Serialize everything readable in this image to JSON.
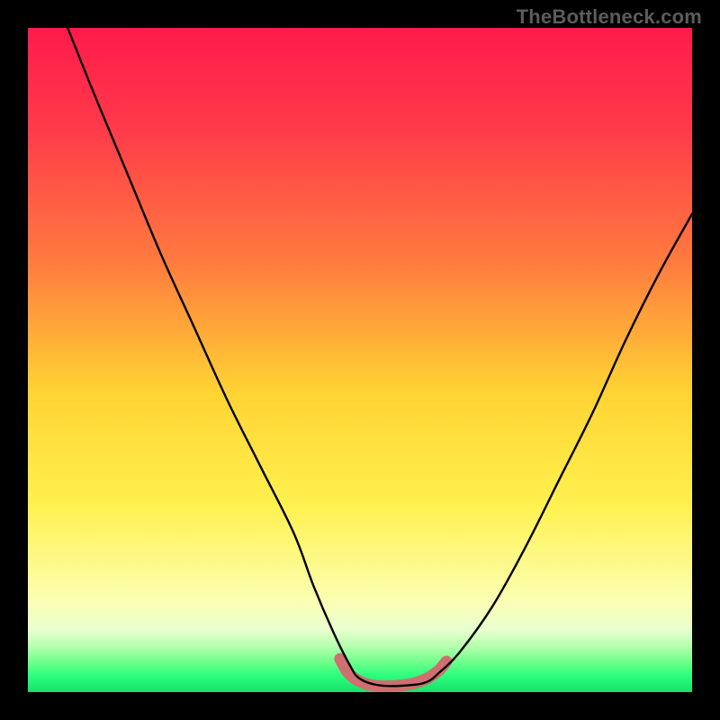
{
  "watermark": "TheBottleneck.com",
  "chart_data": {
    "type": "line",
    "title": "",
    "xlabel": "",
    "ylabel": "",
    "xlim": [
      0,
      100
    ],
    "ylim": [
      0,
      100
    ],
    "gradient_stops": [
      {
        "offset": 0.0,
        "color": "#ff1a4b"
      },
      {
        "offset": 0.15,
        "color": "#ff3a4a"
      },
      {
        "offset": 0.35,
        "color": "#ff7a3f"
      },
      {
        "offset": 0.55,
        "color": "#ffd433"
      },
      {
        "offset": 0.72,
        "color": "#fff150"
      },
      {
        "offset": 0.86,
        "color": "#fbffb0"
      },
      {
        "offset": 0.905,
        "color": "#eaffd0"
      },
      {
        "offset": 0.93,
        "color": "#b8ffb0"
      },
      {
        "offset": 0.955,
        "color": "#6fff8a"
      },
      {
        "offset": 0.975,
        "color": "#2bff7d"
      },
      {
        "offset": 1.0,
        "color": "#18e06c"
      }
    ],
    "series": [
      {
        "name": "bottleneck-curve",
        "x": [
          6,
          10,
          15,
          20,
          25,
          30,
          35,
          40,
          43,
          46,
          48.5,
          50,
          53,
          57,
          60,
          62,
          65,
          70,
          75,
          80,
          85,
          90,
          95,
          100
        ],
        "y": [
          100,
          90,
          78,
          66,
          55,
          44,
          34,
          24,
          16,
          9,
          4,
          2,
          1,
          1,
          1.5,
          3,
          6,
          13,
          22,
          32,
          42,
          53,
          63,
          72
        ]
      }
    ],
    "annotations": [
      {
        "name": "trough-band",
        "color": "#cf6f6f",
        "x": [
          47,
          48,
          49,
          50,
          51,
          52,
          53,
          54,
          55,
          56,
          57,
          58,
          59,
          60,
          61,
          62,
          63
        ],
        "y": [
          5,
          3.2,
          2.2,
          1.6,
          1.2,
          1.0,
          0.9,
          0.9,
          0.9,
          1.0,
          1.1,
          1.3,
          1.6,
          2.0,
          2.6,
          3.4,
          4.6
        ]
      }
    ]
  }
}
